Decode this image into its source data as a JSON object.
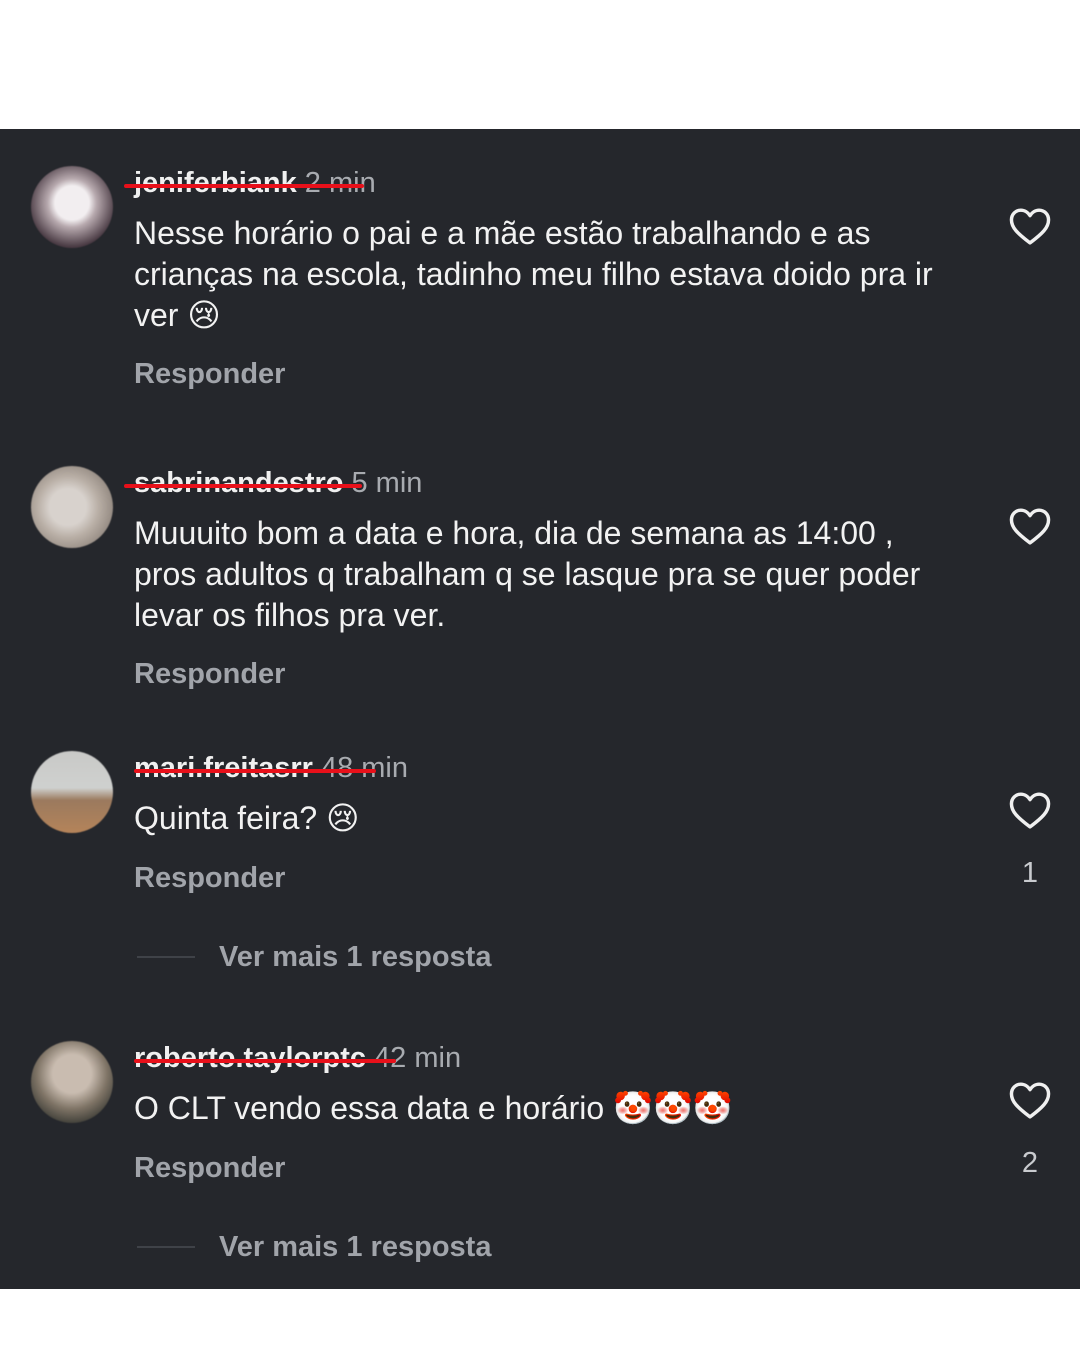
{
  "comments": [
    {
      "username": "jeniferbiank",
      "time": "2 min",
      "text": "Nesse horário o pai e a mãe estão trabalhando e as crianças na escola, tadinho meu filho estava doido pra ir ver",
      "emoji": "😢",
      "reply_label": "Responder",
      "like_icon": "heart-outline-icon"
    },
    {
      "username": "sabrinandestro",
      "time": "5 min",
      "text": "Muuuito bom a data e hora, dia de semana as 14:00 , pros adultos q trabalham q se lasque pra se quer poder levar os filhos pra ver.",
      "reply_label": "Responder",
      "like_icon": "heart-outline-icon"
    },
    {
      "username": "mari.freitasrr",
      "time": "48 min",
      "text": "Quinta feira?",
      "emoji": "😢",
      "reply_label": "Responder",
      "like_count": "1",
      "view_more": "Ver mais 1 resposta",
      "like_icon": "heart-outline-icon"
    },
    {
      "username": "roberto.taylorptc",
      "time": "42 min",
      "text": "O CLT vendo essa data e horário",
      "emoji": "🤡🤡🤡",
      "reply_label": "Responder",
      "like_count": "2",
      "view_more": "Ver mais 1 resposta",
      "like_icon": "heart-outline-icon"
    }
  ],
  "colors": {
    "background": "#25272c",
    "strike": "#e8101a",
    "muted": "#a1a4aa"
  }
}
